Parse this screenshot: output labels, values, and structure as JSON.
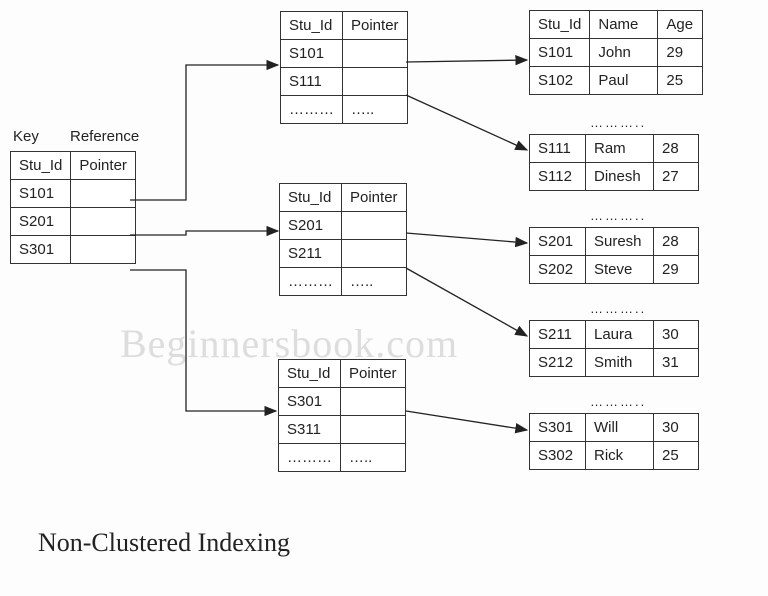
{
  "title": "Non-Clustered Indexing",
  "watermark": "Beginnersbook.com",
  "labels": {
    "key": "Key",
    "reference": "Reference",
    "dots_long": "………..",
    "row_dots_a": "………",
    "row_dots_b": "….."
  },
  "primary": {
    "h1": "Stu_Id",
    "h2": "Pointer",
    "r1": "S101",
    "r2": "S201",
    "r3": "S301"
  },
  "mid1": {
    "h1": "Stu_Id",
    "h2": "Pointer",
    "r1": "S101",
    "r2": "S111"
  },
  "mid2": {
    "h1": "Stu_Id",
    "h2": "Pointer",
    "r1": "S201",
    "r2": "S211"
  },
  "mid3": {
    "h1": "Stu_Id",
    "h2": "Pointer",
    "r1": "S301",
    "r2": "S311"
  },
  "data_hdr": {
    "c1": "Stu_Id",
    "c2": "Name",
    "c3": "Age"
  },
  "d1": {
    "r1c1": "S101",
    "r1c2": "John",
    "r1c3": "29",
    "r2c1": "S102",
    "r2c2": "Paul",
    "r2c3": "25"
  },
  "d2": {
    "r1c1": "S111",
    "r1c2": "Ram",
    "r1c3": "28",
    "r2c1": "S112",
    "r2c2": "Dinesh",
    "r2c3": "27"
  },
  "d3": {
    "r1c1": "S201",
    "r1c2": "Suresh",
    "r1c3": "28",
    "r2c1": "S202",
    "r2c2": "Steve",
    "r2c3": "29"
  },
  "d4": {
    "r1c1": "S211",
    "r1c2": "Laura",
    "r1c3": "30",
    "r2c1": "S212",
    "r2c2": "Smith",
    "r2c3": "31"
  },
  "d5": {
    "r1c1": "S301",
    "r1c2": "Will",
    "r1c3": "30",
    "r2c1": "S302",
    "r2c2": "Rick",
    "r2c3": "25"
  }
}
